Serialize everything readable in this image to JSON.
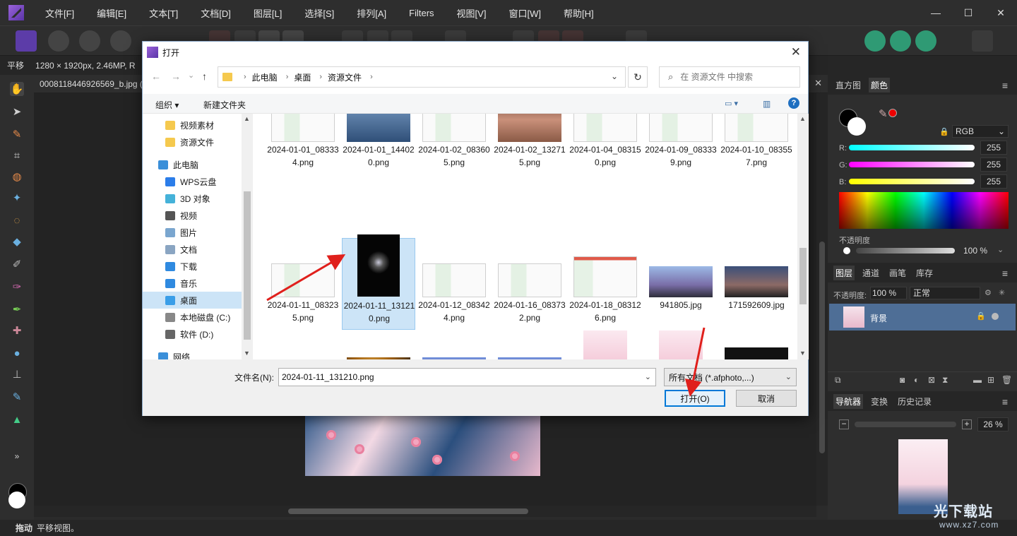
{
  "menubar": {
    "items": [
      "文件[F]",
      "编辑[E]",
      "文本[T]",
      "文档[D]",
      "图层[L]",
      "选择[S]",
      "排列[A]",
      "Filters",
      "视图[V]",
      "窗口[W]",
      "帮助[H]"
    ],
    "win_controls": [
      "—",
      "☐",
      "✕"
    ]
  },
  "context_toolbar": {
    "tool": "平移",
    "info": "1280 × 1920px, 2.46MP, R"
  },
  "document_tab": {
    "name": "0008118446926569_b.jpg (2",
    "close": "✕"
  },
  "status_bar": {
    "bold": "拖动",
    "text": "平移视图。"
  },
  "right_panel": {
    "color_tabs": [
      "直方图",
      "颜色"
    ],
    "color_mode": "RGB",
    "r_label": "R:",
    "g_label": "G:",
    "b_label": "B:",
    "r_value": "255",
    "g_value": "255",
    "b_value": "255",
    "opacity_label": "不透明度",
    "opacity_value": "100 %",
    "layers_tabs": [
      "图层",
      "通道",
      "画笔",
      "库存"
    ],
    "layers_opacity_label": "不透明度:",
    "layers_opacity_value": "100 %",
    "blend_mode": "正常",
    "layer_name": "背景",
    "nav_tabs": [
      "导航器",
      "变换",
      "历史记录"
    ],
    "zoom_value": "26 %"
  },
  "dialog": {
    "title": "打开",
    "close": "✕",
    "breadcrumb": [
      "此电脑",
      "桌面",
      "资源文件"
    ],
    "refresh": "↻",
    "search_placeholder": "在 资源文件 中搜索",
    "cmd_organize": "组织 ▾",
    "cmd_new_folder": "新建文件夹",
    "help": "?",
    "nav_items": [
      {
        "label": "视频素材",
        "color": "#f5c94e"
      },
      {
        "label": "资源文件",
        "color": "#f5c94e"
      },
      {
        "label": "此电脑",
        "color": "#3a8fd9"
      },
      {
        "label": "WPS云盘",
        "color": "#2b7de9"
      },
      {
        "label": "3D 对象",
        "color": "#45b2d9"
      },
      {
        "label": "视频",
        "color": "#555"
      },
      {
        "label": "图片",
        "color": "#7aa6cf"
      },
      {
        "label": "文档",
        "color": "#8aa5c2"
      },
      {
        "label": "下载",
        "color": "#2f8ae0"
      },
      {
        "label": "音乐",
        "color": "#2f8ae0"
      },
      {
        "label": "桌面",
        "color": "#3a9ee8"
      },
      {
        "label": "本地磁盘 (C:)",
        "color": "#888"
      },
      {
        "label": "软件 (D:)",
        "color": "#666"
      },
      {
        "label": "网络",
        "color": "#3a8fd9"
      }
    ],
    "files": [
      {
        "name": "2024-01-01_083334.png",
        "kind": "sheet"
      },
      {
        "name": "2024-01-01_144020.png",
        "kind": "bird"
      },
      {
        "name": "2024-01-02_083605.png",
        "kind": "sheet"
      },
      {
        "name": "2024-01-02_132715.png",
        "kind": "face"
      },
      {
        "name": "2024-01-04_083150.png",
        "kind": "sheet"
      },
      {
        "name": "2024-01-09_083339.png",
        "kind": "sheet"
      },
      {
        "name": "2024-01-10_083557.png",
        "kind": "sheet"
      },
      {
        "name": "2024-01-11_083235.png",
        "kind": "sheet"
      },
      {
        "name": "2024-01-11_131210.png",
        "kind": "dark-portrait",
        "selected": true
      },
      {
        "name": "2024-01-12_083424.png",
        "kind": "sheet"
      },
      {
        "name": "2024-01-16_083732.png",
        "kind": "sheet"
      },
      {
        "name": "2024-01-18_083126.png",
        "kind": "sheet-color"
      },
      {
        "name": "941805.jpg",
        "kind": "panorama"
      },
      {
        "name": "171592609.jpg",
        "kind": "city"
      },
      {
        "name": "",
        "kind": "harbor"
      },
      {
        "name": "",
        "kind": "leaf"
      },
      {
        "name": "",
        "kind": "sunset"
      },
      {
        "name": "",
        "kind": "sunset"
      },
      {
        "name": "",
        "kind": "blossom"
      },
      {
        "name": "",
        "kind": "blossom"
      },
      {
        "name": "",
        "kind": "black"
      }
    ],
    "filename_label": "文件名(N):",
    "filename_value": "2024-01-11_131210.png",
    "filetype_value": "所有文档 (*.afphoto,...)",
    "open_button": "打开(O)",
    "cancel_button": "取消"
  },
  "watermark": {
    "title": "光下载站",
    "url": "www.xz7.com"
  }
}
